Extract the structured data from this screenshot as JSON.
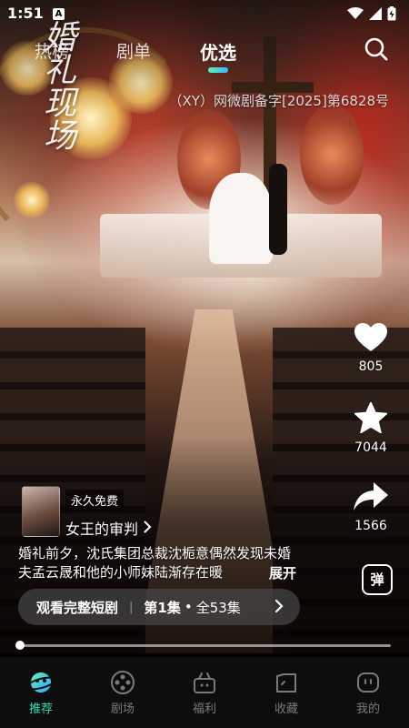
{
  "status_bar": {
    "time": "1:51",
    "notification_badge": "A",
    "icons": [
      "wifi-icon",
      "signal-icon",
      "battery-charging-icon"
    ]
  },
  "video_overlay_title": "婚礼现场",
  "top_tabs": {
    "items": [
      {
        "label": "热榜",
        "active": false
      },
      {
        "label": "剧单",
        "active": false
      },
      {
        "label": "优选",
        "active": true
      }
    ],
    "search_icon": "search-icon",
    "accent_gradient": [
      "#5ff0c0",
      "#3fb5f8"
    ]
  },
  "license_text": "（XY）网微剧备字[2025]第6828号",
  "actions": {
    "like": {
      "icon": "heart-icon",
      "count": "805"
    },
    "favorite": {
      "icon": "star-icon",
      "count": "7044"
    },
    "share": {
      "icon": "share-arrow-icon",
      "count": "1566"
    },
    "danmaku": {
      "icon": "danmaku-icon",
      "label": "弹"
    }
  },
  "drama": {
    "free_tag": "永久免费",
    "title": "女王的审判",
    "synopsis": "婚礼前夕，沈氏集团总裁沈栀意偶然发现未婚夫孟云晟和他的小师妹陆渐存在暖",
    "expand_label": "展开"
  },
  "watch_bar": {
    "label": "观看完整短剧",
    "episode": "第1集",
    "total": "全53集"
  },
  "playback": {
    "progress": 0.005
  },
  "bottom_nav": {
    "items": [
      {
        "label": "推荐",
        "icon": "planet-icon",
        "active": true
      },
      {
        "label": "剧场",
        "icon": "film-reel-icon",
        "active": false
      },
      {
        "label": "福利",
        "icon": "gift-icon",
        "active": false
      },
      {
        "label": "收藏",
        "icon": "folder-icon",
        "active": false
      },
      {
        "label": "我的",
        "icon": "profile-face-icon",
        "active": false
      }
    ],
    "active_color": "#38e0b2",
    "inactive_color": "#7a7a7a"
  }
}
